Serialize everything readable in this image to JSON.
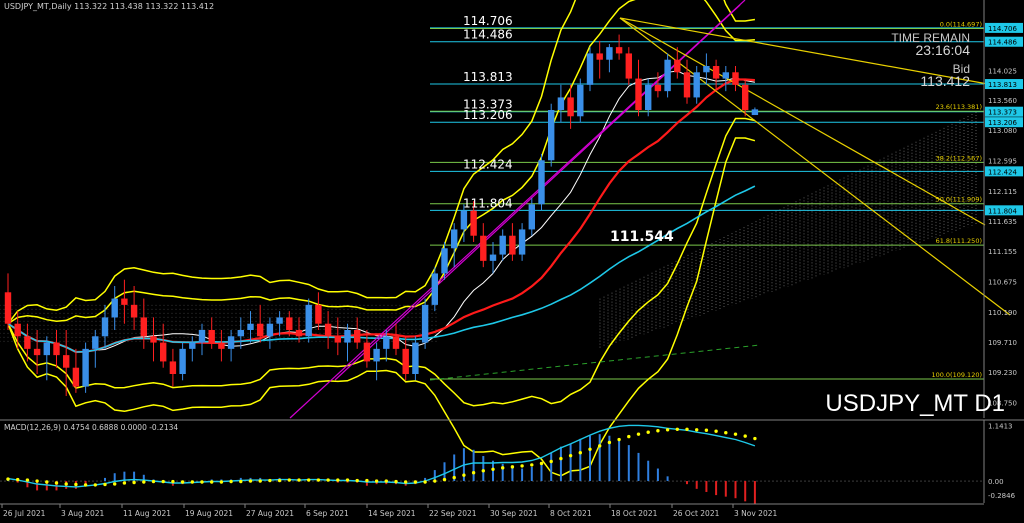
{
  "header": {
    "text": "USDJPY_MT,Daily  113.322 113.438 113.322 113.412"
  },
  "info": {
    "time_remain_label": "TIME REMAIN",
    "time_remain_value": "23:16:04",
    "bid_label": "Bid",
    "bid_value": "113.412",
    "symbol_label": "USDJPY_MT D1"
  },
  "colors": {
    "background": "#000000",
    "bull": "#3a8fe8",
    "bear": "#ff2020",
    "macd_line": "#1ec8e8",
    "signal": "#ffff00",
    "hist_pos": "#2f7fe0",
    "hist_neg": "#e02020",
    "level_cyan": "#1ec8e8",
    "level_green": "#7ac94a",
    "fib_yellow": "#e8d000",
    "magenta": "#d000d0",
    "ma_red": "#ff1a1a",
    "band_yellow": "#ffff00",
    "ma_cyan": "#1ec8e8",
    "text_grey": "#c8c8c8"
  },
  "chart_data": {
    "type": "candlestick",
    "symbol": "USDJPY_MT",
    "timeframe": "Daily",
    "ylim": [
      108.5,
      115.15
    ],
    "y_ticks": [
      "114.706",
      "114.486",
      "114.025",
      "113.813",
      "113.560",
      "113.373",
      "113.206",
      "113.080",
      "112.595",
      "112.424",
      "112.115",
      "111.804",
      "111.635",
      "111.155",
      "110.675",
      "110.190",
      "109.710",
      "109.230",
      "108.750"
    ],
    "x_ticks": [
      "26 Jul 2021",
      "3 Aug 2021",
      "11 Aug 2021",
      "19 Aug 2021",
      "27 Aug 2021",
      "6 Sep 2021",
      "14 Sep 2021",
      "22 Sep 2021",
      "30 Sep 2021",
      "8 Oct 2021",
      "18 Oct 2021",
      "26 Oct 2021",
      "3 Nov 2021"
    ],
    "candles": [
      {
        "o": 110.5,
        "h": 110.8,
        "l": 109.9,
        "c": 110.0
      },
      {
        "o": 110.0,
        "h": 110.2,
        "l": 109.6,
        "c": 109.8
      },
      {
        "o": 109.8,
        "h": 110.0,
        "l": 109.4,
        "c": 109.6
      },
      {
        "o": 109.6,
        "h": 109.9,
        "l": 109.2,
        "c": 109.5
      },
      {
        "o": 109.5,
        "h": 109.8,
        "l": 109.1,
        "c": 109.7
      },
      {
        "o": 109.7,
        "h": 109.9,
        "l": 109.3,
        "c": 109.5
      },
      {
        "o": 109.5,
        "h": 109.9,
        "l": 108.85,
        "c": 109.3
      },
      {
        "o": 109.3,
        "h": 109.6,
        "l": 108.9,
        "c": 109.0
      },
      {
        "o": 109.0,
        "h": 109.7,
        "l": 108.9,
        "c": 109.6
      },
      {
        "o": 109.6,
        "h": 109.9,
        "l": 109.3,
        "c": 109.8
      },
      {
        "o": 109.8,
        "h": 110.3,
        "l": 109.6,
        "c": 110.1
      },
      {
        "o": 110.1,
        "h": 110.6,
        "l": 109.9,
        "c": 110.4
      },
      {
        "o": 110.4,
        "h": 110.7,
        "l": 110.0,
        "c": 110.3
      },
      {
        "o": 110.3,
        "h": 110.6,
        "l": 109.9,
        "c": 110.1
      },
      {
        "o": 110.1,
        "h": 110.4,
        "l": 109.6,
        "c": 109.8
      },
      {
        "o": 109.8,
        "h": 110.1,
        "l": 109.4,
        "c": 109.7
      },
      {
        "o": 109.7,
        "h": 110.0,
        "l": 109.3,
        "c": 109.4
      },
      {
        "o": 109.4,
        "h": 109.6,
        "l": 109.0,
        "c": 109.2
      },
      {
        "o": 109.2,
        "h": 109.7,
        "l": 109.1,
        "c": 109.6
      },
      {
        "o": 109.6,
        "h": 109.8,
        "l": 109.4,
        "c": 109.7
      },
      {
        "o": 109.7,
        "h": 110.0,
        "l": 109.5,
        "c": 109.9
      },
      {
        "o": 109.9,
        "h": 110.1,
        "l": 109.6,
        "c": 109.7
      },
      {
        "o": 109.7,
        "h": 109.9,
        "l": 109.4,
        "c": 109.6
      },
      {
        "o": 109.6,
        "h": 109.9,
        "l": 109.4,
        "c": 109.8
      },
      {
        "o": 109.8,
        "h": 110.1,
        "l": 109.6,
        "c": 109.9
      },
      {
        "o": 109.9,
        "h": 110.2,
        "l": 109.7,
        "c": 110.0
      },
      {
        "o": 110.0,
        "h": 110.3,
        "l": 109.7,
        "c": 109.8
      },
      {
        "o": 109.8,
        "h": 110.1,
        "l": 109.6,
        "c": 110.0
      },
      {
        "o": 110.0,
        "h": 110.2,
        "l": 109.8,
        "c": 110.1
      },
      {
        "o": 110.1,
        "h": 110.2,
        "l": 109.8,
        "c": 109.9
      },
      {
        "o": 109.9,
        "h": 110.1,
        "l": 109.7,
        "c": 109.8
      },
      {
        "o": 109.8,
        "h": 110.4,
        "l": 109.7,
        "c": 110.3
      },
      {
        "o": 110.3,
        "h": 110.5,
        "l": 109.9,
        "c": 110.0
      },
      {
        "o": 110.0,
        "h": 110.2,
        "l": 109.6,
        "c": 109.8
      },
      {
        "o": 109.8,
        "h": 110.1,
        "l": 109.5,
        "c": 109.7
      },
      {
        "o": 109.7,
        "h": 110.0,
        "l": 109.4,
        "c": 109.9
      },
      {
        "o": 109.9,
        "h": 110.1,
        "l": 109.6,
        "c": 109.7
      },
      {
        "o": 109.7,
        "h": 109.9,
        "l": 109.3,
        "c": 109.4
      },
      {
        "o": 109.4,
        "h": 109.7,
        "l": 109.1,
        "c": 109.6
      },
      {
        "o": 109.6,
        "h": 109.9,
        "l": 109.4,
        "c": 109.8
      },
      {
        "o": 109.8,
        "h": 110.0,
        "l": 109.5,
        "c": 109.6
      },
      {
        "o": 109.6,
        "h": 109.8,
        "l": 109.1,
        "c": 109.2
      },
      {
        "o": 109.2,
        "h": 109.8,
        "l": 109.1,
        "c": 109.7
      },
      {
        "o": 109.7,
        "h": 110.4,
        "l": 109.6,
        "c": 110.3
      },
      {
        "o": 110.3,
        "h": 110.9,
        "l": 110.2,
        "c": 110.8
      },
      {
        "o": 110.8,
        "h": 111.3,
        "l": 110.7,
        "c": 111.2
      },
      {
        "o": 111.2,
        "h": 111.6,
        "l": 110.9,
        "c": 111.5
      },
      {
        "o": 111.5,
        "h": 111.9,
        "l": 111.3,
        "c": 111.8
      },
      {
        "o": 111.8,
        "h": 111.95,
        "l": 111.3,
        "c": 111.4
      },
      {
        "o": 111.4,
        "h": 111.6,
        "l": 110.9,
        "c": 111.0
      },
      {
        "o": 111.0,
        "h": 111.3,
        "l": 110.8,
        "c": 111.1
      },
      {
        "o": 111.1,
        "h": 111.5,
        "l": 111.0,
        "c": 111.4
      },
      {
        "o": 111.4,
        "h": 111.6,
        "l": 111.0,
        "c": 111.1
      },
      {
        "o": 111.1,
        "h": 111.6,
        "l": 111.0,
        "c": 111.5
      },
      {
        "o": 111.5,
        "h": 112.0,
        "l": 111.4,
        "c": 111.9
      },
      {
        "o": 111.9,
        "h": 112.7,
        "l": 111.8,
        "c": 112.6
      },
      {
        "o": 112.6,
        "h": 113.5,
        "l": 112.5,
        "c": 113.4
      },
      {
        "o": 113.4,
        "h": 113.8,
        "l": 113.2,
        "c": 113.6
      },
      {
        "o": 113.6,
        "h": 113.8,
        "l": 113.1,
        "c": 113.3
      },
      {
        "o": 113.3,
        "h": 113.9,
        "l": 113.2,
        "c": 113.8
      },
      {
        "o": 113.8,
        "h": 114.4,
        "l": 113.7,
        "c": 114.3
      },
      {
        "o": 114.3,
        "h": 114.5,
        "l": 113.9,
        "c": 114.2
      },
      {
        "o": 114.2,
        "h": 114.45,
        "l": 114.0,
        "c": 114.4
      },
      {
        "o": 114.4,
        "h": 114.6,
        "l": 114.2,
        "c": 114.3
      },
      {
        "o": 114.3,
        "h": 114.4,
        "l": 113.8,
        "c": 113.9
      },
      {
        "o": 113.9,
        "h": 114.2,
        "l": 113.3,
        "c": 113.4
      },
      {
        "o": 113.4,
        "h": 113.9,
        "l": 113.3,
        "c": 113.8
      },
      {
        "o": 113.8,
        "h": 114.0,
        "l": 113.6,
        "c": 113.7
      },
      {
        "o": 113.7,
        "h": 114.3,
        "l": 113.6,
        "c": 114.2
      },
      {
        "o": 114.2,
        "h": 114.4,
        "l": 113.9,
        "c": 114.0
      },
      {
        "o": 114.0,
        "h": 114.2,
        "l": 113.5,
        "c": 113.6
      },
      {
        "o": 113.6,
        "h": 114.1,
        "l": 113.5,
        "c": 114.0
      },
      {
        "o": 114.0,
        "h": 114.3,
        "l": 113.8,
        "c": 114.1
      },
      {
        "o": 114.1,
        "h": 114.2,
        "l": 113.7,
        "c": 113.9
      },
      {
        "o": 113.9,
        "h": 114.1,
        "l": 113.7,
        "c": 114.0
      },
      {
        "o": 114.0,
        "h": 114.1,
        "l": 113.7,
        "c": 113.8
      },
      {
        "o": 113.8,
        "h": 113.9,
        "l": 113.3,
        "c": 113.4
      },
      {
        "o": 113.32,
        "h": 113.44,
        "l": 113.32,
        "c": 113.41
      }
    ],
    "levels": [
      {
        "price": 114.706,
        "label": "114.706",
        "color": "cyan"
      },
      {
        "price": 114.486,
        "label": "114.486",
        "color": "cyan"
      },
      {
        "price": 113.813,
        "label": "113.813",
        "color": "cyan"
      },
      {
        "price": 113.373,
        "label": "113.373",
        "color": "cyan"
      },
      {
        "price": 113.206,
        "label": "113.206",
        "color": "cyan"
      },
      {
        "price": 112.424,
        "label": "112.424",
        "color": "cyan"
      },
      {
        "price": 111.804,
        "label": "111.804",
        "color": "cyan"
      }
    ],
    "fib_levels": [
      {
        "price": 114.697,
        "label": "0.0(114.697)"
      },
      {
        "price": 113.381,
        "label": "23.6(113.381)"
      },
      {
        "price": 112.567,
        "label": "38.2(112.567)"
      },
      {
        "price": 111.909,
        "label": "50.0(111.909)"
      },
      {
        "price": 111.25,
        "label": "61.8(111.250)"
      },
      {
        "price": 109.12,
        "label": "100.0(109.120)"
      }
    ],
    "annotation": "111.544",
    "macd": {
      "label": "MACD(12,26,9) 0.4754 0.6888 0.0000 -0.2134",
      "ylim": [
        -0.45,
        1.25
      ],
      "ticks": [
        "1.1413",
        "0.00",
        "-0.2846"
      ],
      "line": [
        0.05,
        0.02,
        -0.02,
        -0.06,
        -0.08,
        -0.1,
        -0.11,
        -0.12,
        -0.1,
        -0.08,
        -0.05,
        -0.01,
        0.02,
        0.03,
        0.02,
        0.0,
        -0.02,
        -0.04,
        -0.04,
        -0.03,
        -0.02,
        -0.01,
        -0.01,
        0.0,
        0.01,
        0.02,
        0.02,
        0.02,
        0.03,
        0.03,
        0.02,
        0.03,
        0.03,
        0.02,
        0.01,
        0.01,
        0.0,
        -0.02,
        -0.02,
        -0.02,
        -0.03,
        -0.05,
        -0.04,
        0.0,
        0.07,
        0.15,
        0.24,
        0.33,
        0.37,
        0.37,
        0.37,
        0.38,
        0.38,
        0.39,
        0.42,
        0.48,
        0.58,
        0.68,
        0.76,
        0.85,
        0.94,
        1.02,
        1.08,
        1.12,
        1.14,
        1.14,
        1.13,
        1.11,
        1.08,
        1.06,
        1.04,
        1.0,
        0.97,
        0.93,
        0.89,
        0.85,
        0.79,
        0.72
      ],
      "signal": [
        0.04,
        0.03,
        0.02,
        0.0,
        -0.02,
        -0.04,
        -0.06,
        -0.07,
        -0.08,
        -0.08,
        -0.07,
        -0.06,
        -0.04,
        -0.03,
        -0.02,
        -0.01,
        -0.01,
        -0.01,
        -0.02,
        -0.02,
        -0.02,
        -0.02,
        -0.02,
        -0.01,
        -0.01,
        0.0,
        0.0,
        0.01,
        0.01,
        0.02,
        0.02,
        0.02,
        0.02,
        0.02,
        0.02,
        0.02,
        0.01,
        0.01,
        0.0,
        0.0,
        -0.01,
        -0.02,
        -0.02,
        -0.02,
        0.0,
        0.03,
        0.07,
        0.12,
        0.17,
        0.21,
        0.24,
        0.27,
        0.29,
        0.31,
        0.33,
        0.36,
        0.4,
        0.46,
        0.52,
        0.58,
        0.65,
        0.72,
        0.79,
        0.85,
        0.91,
        0.96,
        1.0,
        1.03,
        1.05,
        1.06,
        1.06,
        1.05,
        1.04,
        1.02,
        0.99,
        0.96,
        0.92,
        0.87
      ]
    }
  }
}
